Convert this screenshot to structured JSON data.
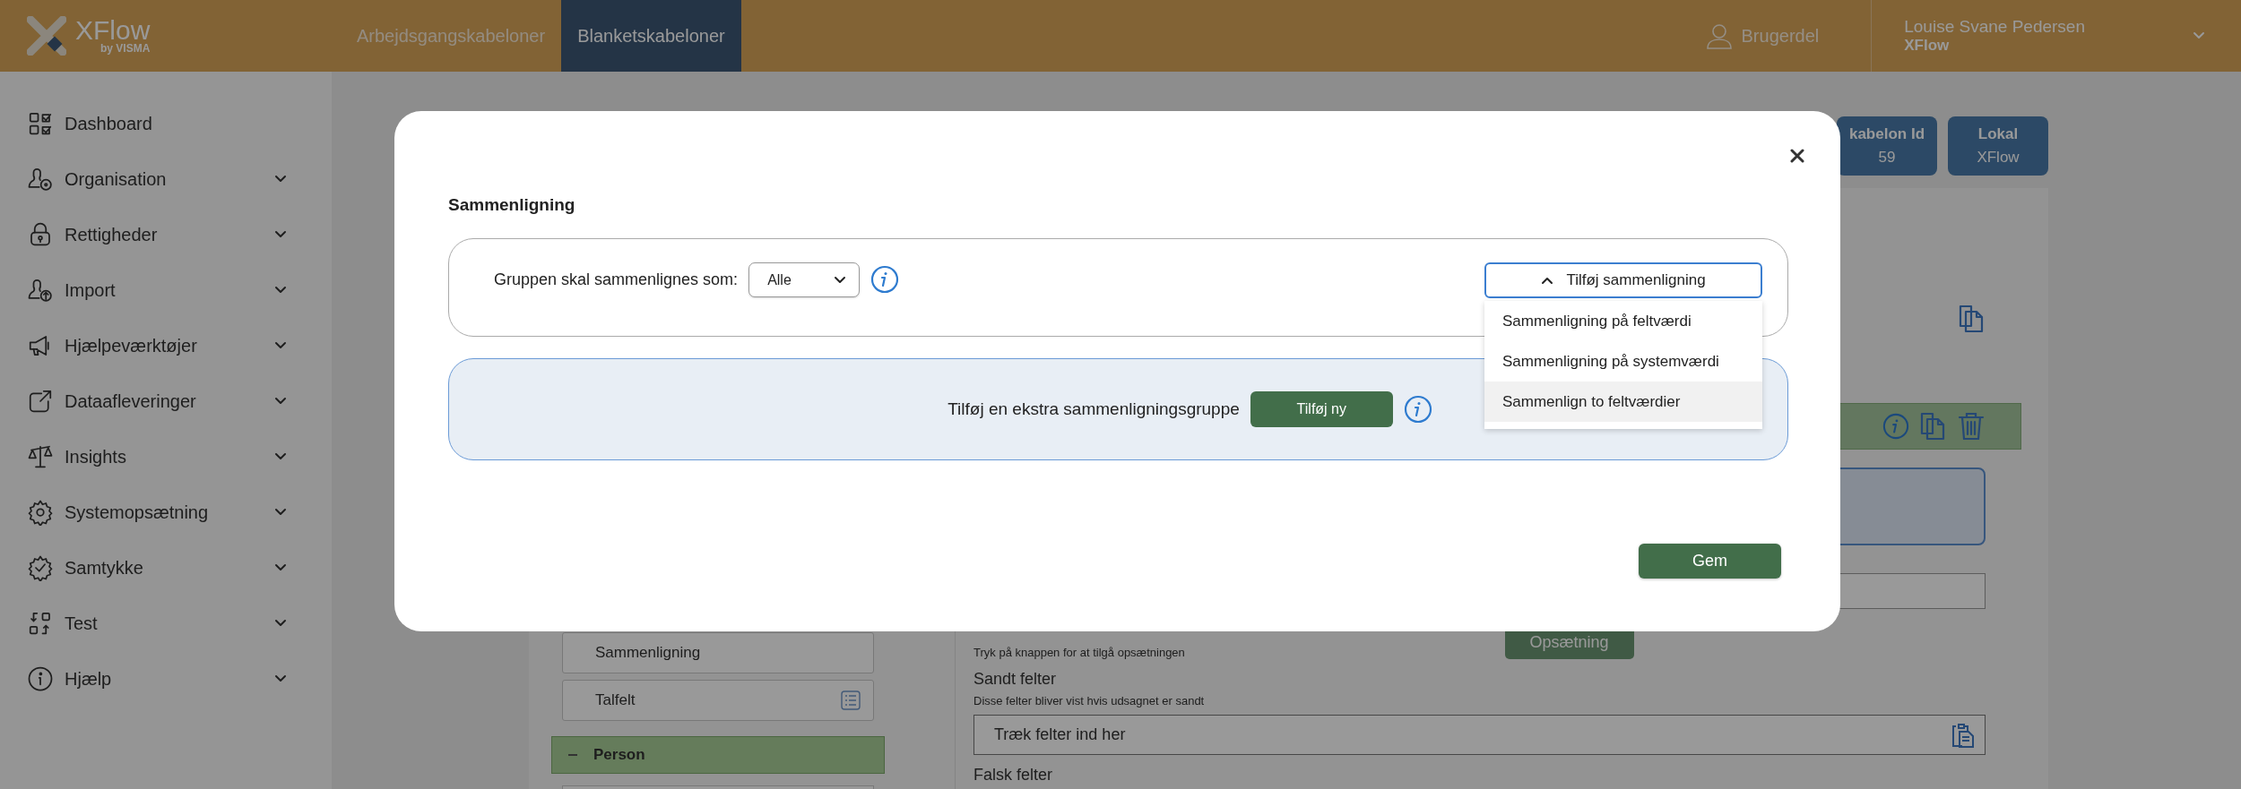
{
  "header": {
    "logo": {
      "name": "XFlow",
      "sub": "by VISMA"
    },
    "nav": [
      {
        "label": "Arbejdsgangskabeloner",
        "selected": false
      },
      {
        "label": "Blanketskabeloner",
        "selected": true
      }
    ],
    "user_area": "Brugerdel",
    "user": {
      "name": "Louise Svane Pedersen",
      "org": "XFlow"
    }
  },
  "sidebar": {
    "items": [
      {
        "label": "Dashboard",
        "expandable": false
      },
      {
        "label": "Organisation",
        "expandable": true
      },
      {
        "label": "Rettigheder",
        "expandable": true
      },
      {
        "label": "Import",
        "expandable": true
      },
      {
        "label": "Hjælpeværktøjer",
        "expandable": true
      },
      {
        "label": "Dataafleveringer",
        "expandable": true
      },
      {
        "label": "Insights",
        "expandable": true
      },
      {
        "label": "Systemopsætning",
        "expandable": true
      },
      {
        "label": "Samtykke",
        "expandable": true
      },
      {
        "label": "Test",
        "expandable": true
      },
      {
        "label": "Hjælp",
        "expandable": true
      }
    ]
  },
  "info_badges": [
    {
      "label": "kabelon Id",
      "value": "59"
    },
    {
      "label": "Lokal",
      "value": "XFlow"
    }
  ],
  "editor": {
    "left_items": [
      {
        "label": "Sammenligning",
        "icon": false
      },
      {
        "label": "Talfelt",
        "icon": true
      }
    ],
    "section": {
      "label": "Person",
      "expanded": true
    },
    "setup": {
      "hint": "Tryk på knappen for at tilgå opsætningen",
      "button": "Opsætning"
    },
    "true_fields": {
      "title": "Sandt felter",
      "hint": "Disse felter bliver vist hvis udsagnet er sandt",
      "placeholder": "Træk felter ind her"
    },
    "false_fields": {
      "title": "Falsk felter"
    }
  },
  "modal": {
    "title": "Sammenligning",
    "group": {
      "label": "Gruppen skal sammenlignes som:",
      "select": {
        "value": "Alle"
      }
    },
    "add_comparison": {
      "label": "Tilføj sammenligning",
      "expanded": true,
      "options": [
        {
          "label": "Sammenligning på feltværdi",
          "selected": false
        },
        {
          "label": "Sammenligning på systemværdi",
          "selected": false
        },
        {
          "label": "Sammenlign to feltværdier",
          "selected": true
        }
      ]
    },
    "extra_group": {
      "label": "Tilføj en ekstra sammenligningsgruppe",
      "button": "Tilføj ny"
    },
    "save": "Gem"
  }
}
